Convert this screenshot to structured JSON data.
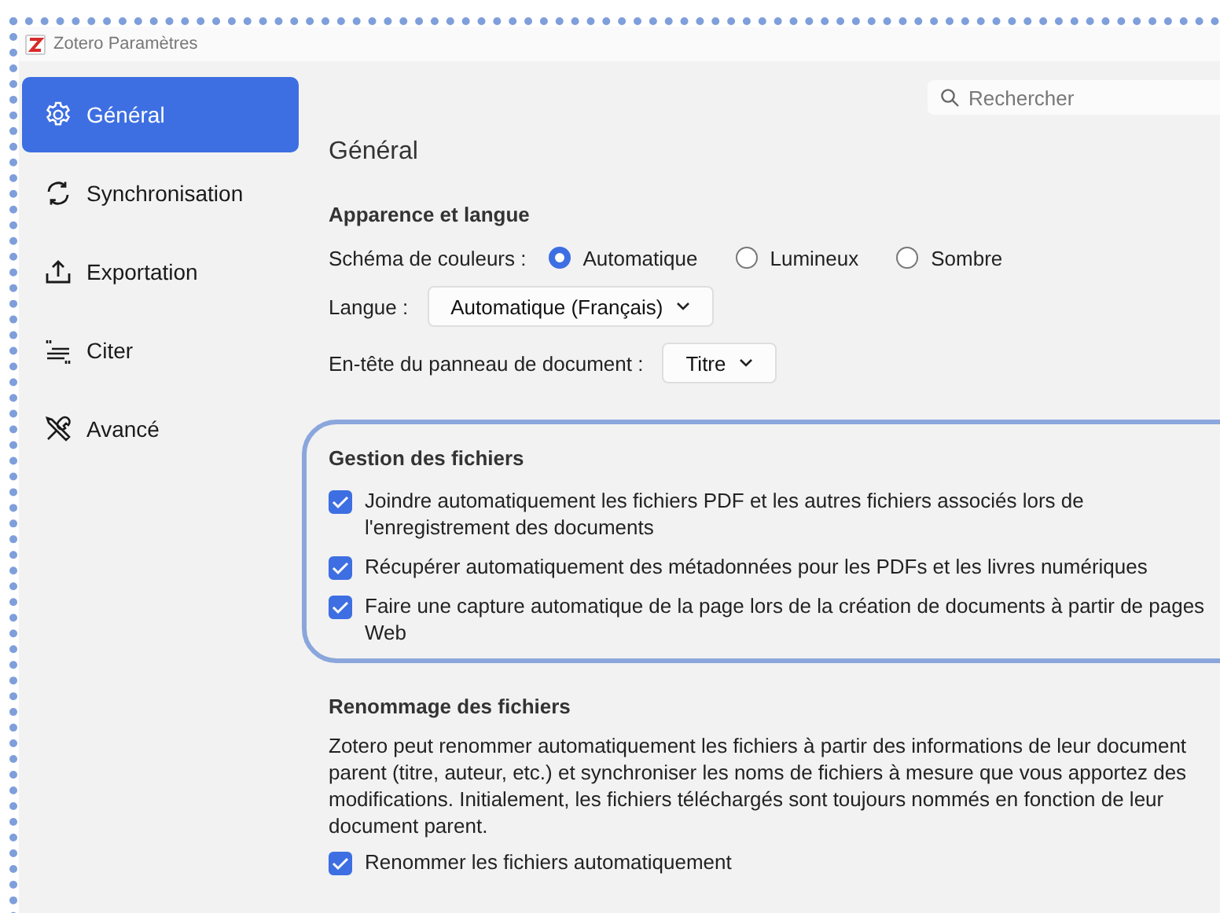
{
  "window": {
    "title": "Zotero Paramètres"
  },
  "sidebar": {
    "items": [
      {
        "label": "Général",
        "selected": true
      },
      {
        "label": "Synchronisation",
        "selected": false
      },
      {
        "label": "Exportation",
        "selected": false
      },
      {
        "label": "Citer",
        "selected": false
      },
      {
        "label": "Avancé",
        "selected": false
      }
    ]
  },
  "search": {
    "placeholder": "Rechercher"
  },
  "page_title": "Général",
  "sections": [
    {
      "title": "Apparence et langue",
      "highlighted": false,
      "rows": [
        {
          "kind": "radio",
          "label": "Schéma de couleurs :",
          "options": [
            {
              "label": "Automatique",
              "selected": true
            },
            {
              "label": "Lumineux",
              "selected": false
            },
            {
              "label": "Sombre",
              "selected": false
            }
          ]
        },
        {
          "kind": "select",
          "label": "Langue :",
          "value": "Automatique (Français)"
        },
        {
          "kind": "select",
          "label": "En-tête du panneau de document :",
          "value": "Titre"
        }
      ]
    },
    {
      "title": "Gestion des fichiers",
      "highlighted": true,
      "rows": [
        {
          "kind": "checkbox",
          "label": "Joindre automatiquement les fichiers PDF et les autres fichiers associés lors de l'enregistrement des documents",
          "checked": true
        },
        {
          "kind": "checkbox",
          "label": "Récupérer automatiquement des métadonnées pour les PDFs et les livres numériques",
          "checked": true
        },
        {
          "kind": "checkbox",
          "label": "Faire une capture automatique de la page lors de la création de documents à partir de pages Web",
          "checked": true
        }
      ]
    },
    {
      "title": "Renommage des fichiers",
      "highlighted": false,
      "rows": [
        {
          "kind": "text",
          "text": "Zotero peut renommer automatiquement les fichiers à partir des informations de leur document parent (titre, auteur, etc.) et synchroniser les noms de fichiers à mesure que vous apportez des modifications. Initialement, les fichiers téléchargés sont toujours nommés en fonction de leur document parent."
        },
        {
          "kind": "checkbox",
          "label": "Renommer les fichiers automatiquement",
          "checked": true
        }
      ]
    }
  ]
}
